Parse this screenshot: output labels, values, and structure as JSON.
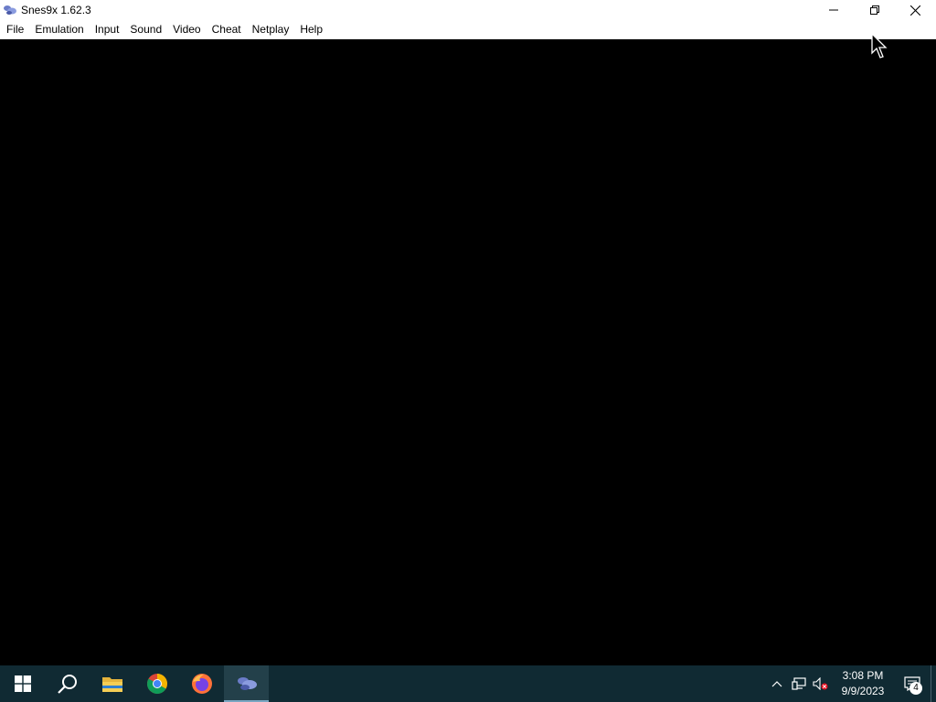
{
  "window": {
    "title": "Snes9x 1.62.3",
    "icon": "snes9x-icon",
    "controls": [
      "minimize-icon",
      "restore-icon",
      "close-icon"
    ]
  },
  "menu": {
    "items": [
      {
        "label": "File"
      },
      {
        "label": "Emulation"
      },
      {
        "label": "Input"
      },
      {
        "label": "Sound"
      },
      {
        "label": "Video"
      },
      {
        "label": "Cheat"
      },
      {
        "label": "Netplay"
      },
      {
        "label": "Help"
      }
    ]
  },
  "taskbar": {
    "apps": [
      "start-icon",
      "search-icon",
      "file-explorer-icon",
      "chrome-icon",
      "firefox-icon",
      "snes9x-icon"
    ],
    "tray": {
      "icons": [
        "chevron-up-icon",
        "network-icon",
        "volume-muted-icon"
      ],
      "time": "3:08 PM",
      "date": "9/9/2023",
      "notification_count": "4"
    }
  },
  "colors": {
    "taskbar_bg": "#102a33",
    "screen_bg": "#000000",
    "titlebar_bg": "#ffffff"
  }
}
